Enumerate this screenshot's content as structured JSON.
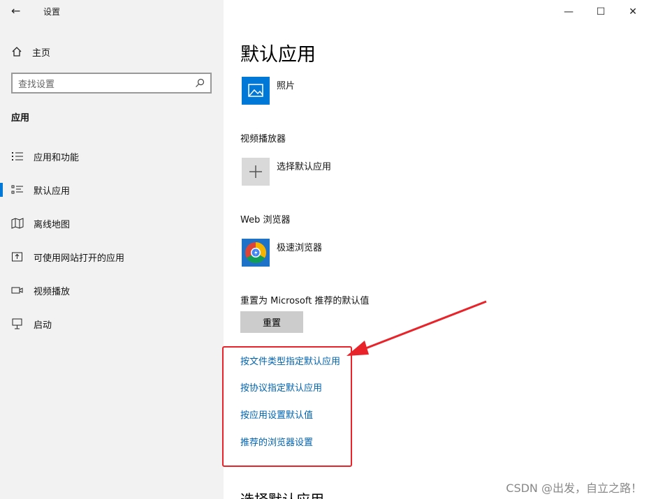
{
  "window": {
    "title": "设置",
    "back_glyph": "←",
    "controls": {
      "minimize": "—",
      "maximize": "☐",
      "close": "✕"
    }
  },
  "sidebar": {
    "home_label": "主页",
    "search_placeholder": "查找设置",
    "section_title": "应用",
    "items": [
      {
        "label": "应用和功能",
        "icon": "list-icon",
        "active": false
      },
      {
        "label": "默认应用",
        "icon": "default-apps-icon",
        "active": true
      },
      {
        "label": "离线地图",
        "icon": "map-icon",
        "active": false
      },
      {
        "label": "可使用网站打开的应用",
        "icon": "website-apps-icon",
        "active": false
      },
      {
        "label": "视频播放",
        "icon": "video-icon",
        "active": false
      },
      {
        "label": "启动",
        "icon": "startup-icon",
        "active": false
      }
    ]
  },
  "main": {
    "title": "默认应用",
    "photo_app": "照片",
    "video_heading": "视频播放器",
    "video_app": "选择默认应用",
    "browser_heading": "Web 浏览器",
    "browser_app": "极速浏览器",
    "reset_heading": "重置为 Microsoft 推荐的默认值",
    "reset_button": "重置",
    "links": [
      "按文件类型指定默认应用",
      "按协议指定默认应用",
      "按应用设置默认值",
      "推荐的浏览器设置"
    ],
    "bottom_heading": "选择默认应用"
  },
  "watermark": "CSDN @出发，自立之路！",
  "colors": {
    "accent": "#0078d7",
    "link": "#0063b1",
    "annotation": "#e8232a"
  }
}
